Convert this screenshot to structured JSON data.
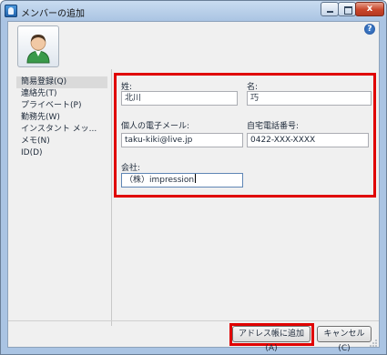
{
  "window": {
    "title": "メンバーの追加",
    "close_glyph": "x"
  },
  "icons": {
    "app": "contact-app-icon",
    "avatar": "person-avatar-icon",
    "help": "help-icon"
  },
  "help_glyph": "?",
  "nav": {
    "items": [
      {
        "label": "簡易登録(Q)",
        "selected": true
      },
      {
        "label": "連絡先(T)"
      },
      {
        "label": "プライベート(P)"
      },
      {
        "label": "勤務先(W)"
      },
      {
        "label": "インスタント メッ..."
      },
      {
        "label": "メモ(N)"
      },
      {
        "label": "ID(D)"
      }
    ]
  },
  "form": {
    "last_name": {
      "label": "姓:",
      "value": "北川"
    },
    "first_name": {
      "label": "名:",
      "value": "巧"
    },
    "email": {
      "label": "個人の電子メール:",
      "value": "taku-kiki@live.jp"
    },
    "home_phone": {
      "label": "自宅電話番号:",
      "value": "0422-XXX-XXXX"
    },
    "company": {
      "label": "会社:",
      "value": "（株）impression"
    }
  },
  "buttons": {
    "add": "アドレス帳に追加(A)",
    "cancel": "キャンセル(C)"
  },
  "colors": {
    "highlight": "#e00000",
    "title_bar": "#aac4e3",
    "client_bg": "#f0f0f0"
  }
}
